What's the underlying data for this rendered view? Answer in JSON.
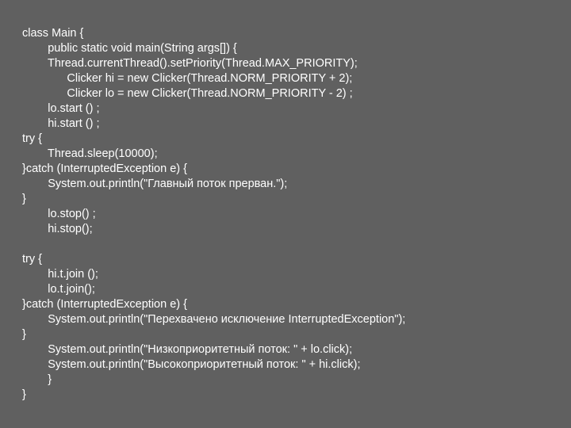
{
  "code": {
    "lines": [
      "class Main {",
      "        public static void main(String args[]) {",
      "        Thread.currentThread().setPriority(Thread.MAX_PRIORITY);",
      "              Clicker hi = new Clicker(Thread.NORM_PRIORITY + 2);",
      "              Clicker lo = new Clicker(Thread.NORM_PRIORITY - 2) ;",
      "        lo.start () ;",
      "        hi.start () ;",
      "try {",
      "        Thread.sleep(10000);",
      "}catch (InterruptedException e) {",
      "        System.out.println(\"Главный поток прерван.\");",
      "}",
      "        lo.stop() ;",
      "        hi.stop();",
      "",
      "try {",
      "        hi.t.join ();",
      "        lo.t.join();",
      "}catch (InterruptedException e) {",
      "        System.out.println(\"Перехвачено исключение InterruptedException\");",
      "}",
      "        System.out.println(\"Низкоприоритетный поток: \" + lo.click);",
      "        System.out.println(\"Высокоприоритетный поток: \" + hi.click);",
      "        }",
      "}"
    ]
  }
}
